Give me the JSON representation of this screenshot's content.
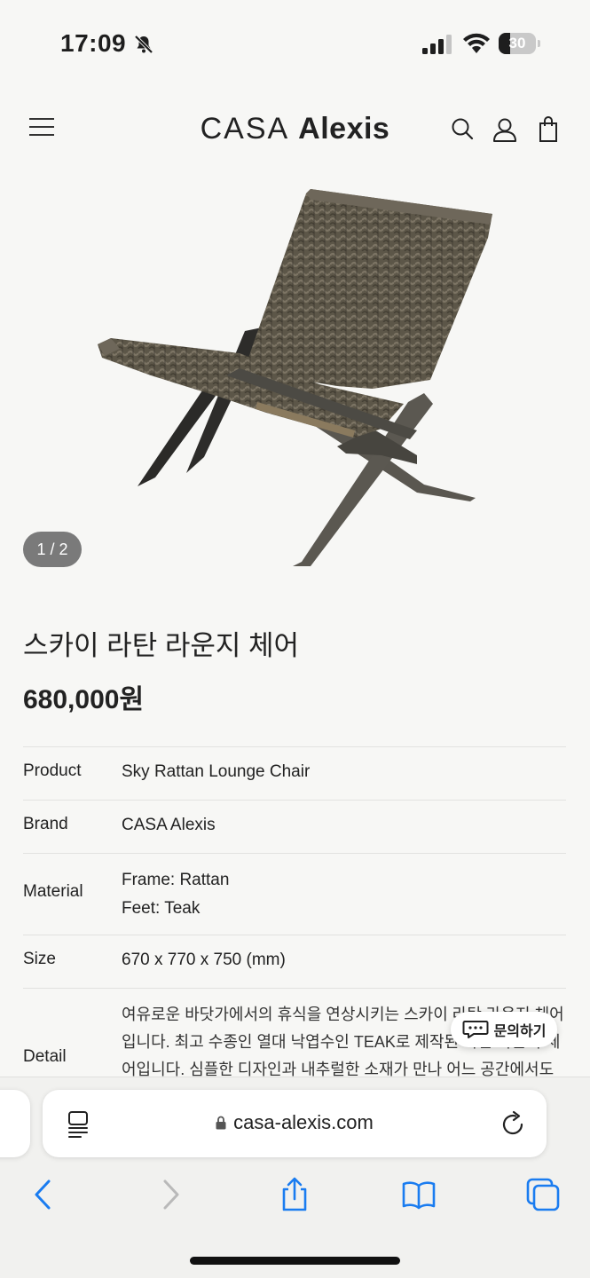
{
  "status_bar": {
    "time": "17:09",
    "battery_level": "30",
    "battery_fraction": 0.3
  },
  "header": {
    "logo_light": "CASA",
    "logo_bold": "Alexis",
    "icons": [
      "menu-icon",
      "search-icon",
      "user-icon",
      "shopping-bag-icon"
    ]
  },
  "product": {
    "slide_indicator": "1 / 2",
    "title": "스카이 라탄 라운지 체어",
    "price": "680,000원",
    "specs": [
      {
        "label": "Product",
        "value": "Sky Rattan Lounge Chair"
      },
      {
        "label": "Brand",
        "value": "CASA Alexis"
      },
      {
        "label": "Material",
        "value_line1": "Frame: Rattan",
        "value_line2": "Feet: Teak"
      },
      {
        "label": "Size",
        "value": "670 x 770 x 750 (mm)"
      },
      {
        "label": "Detail",
        "value": "여유로운 바닷가에서의 휴식을 연상시키는 스카이 라탄 라운지 체어입니다. 최고 수종인 열대 낙엽수인 TEAK로 제작된 라탄 라운지 체어입니다. 심플한 디자인과 내추럴한 소재가 만나 어느 공간에서도 편"
      }
    ]
  },
  "inquiry_button": {
    "label": "문의하기"
  },
  "browser": {
    "url": "casa-alexis.com",
    "icons": [
      "reader-icon",
      "lock-icon",
      "reload-icon",
      "back-icon",
      "forward-icon",
      "share-icon",
      "bookmarks-icon",
      "tabs-icon"
    ]
  },
  "colors": {
    "accent": "#1a7cf0",
    "disabled": "#b9b9b9",
    "background": "#f7f7f5"
  }
}
